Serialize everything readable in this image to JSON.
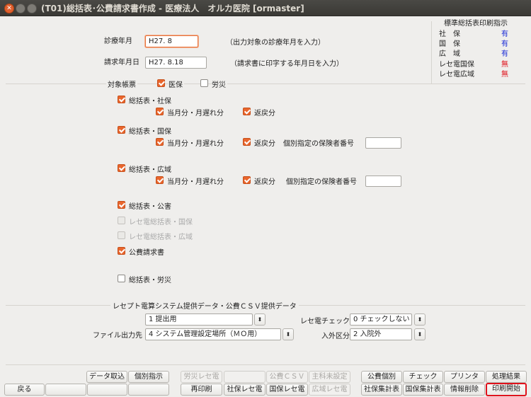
{
  "window": {
    "title": "(T01)総括表･公費請求書作成 - 医療法人　オルカ医院 [ormaster]"
  },
  "form": {
    "shinryo_label": "診療年月",
    "shinryo_value": "H27. 8",
    "shinryo_note": "（出力対象の診療年月を入力）",
    "seikyu_label": "請求年月日",
    "seikyu_value": "H27. 8.18",
    "seikyu_note": "（請求書に印字する年月日を入力）"
  },
  "status_panel": {
    "title": "標準総括表印刷指示",
    "rows": [
      {
        "label": "社　保",
        "value": "有",
        "color": "#1a2bd6"
      },
      {
        "label": "国　保",
        "value": "有",
        "color": "#1a2bd6"
      },
      {
        "label": "広　域",
        "value": "有",
        "color": "#1a2bd6"
      },
      {
        "label": "レセ電国保",
        "value": "無",
        "color": "#e0121c"
      },
      {
        "label": "レセ電広域",
        "value": "無",
        "color": "#e0121c"
      }
    ]
  },
  "target": {
    "label": "対象帳票",
    "iho": "医保",
    "rosai": "労災"
  },
  "options": {
    "shaho": "総括表・社保",
    "kokuho": "総括表・国保",
    "koiki": "総括表・広域",
    "tougetsu": "当月分・月遅れ分",
    "henrei": "返戻分",
    "kobetsu": "個別指定の保険者番号",
    "kogai": "総括表・公害",
    "rece_kokuho": "レセ電総括表・国保",
    "rece_koiki": "レセ電総括表・広域",
    "kouhi": "公費請求書",
    "rosai_summary": "総括表・労災"
  },
  "csv": {
    "section_title": "レセプト電算システム提供データ・公費ＣＳＶ提供データ",
    "teikyo_value": "1 提出用",
    "recheck_label": "レセ電チェック",
    "recheck_value": "0 チェックしない",
    "file_label": "ファイル出力先",
    "file_value": "4 システム管理設定場所（ＭＯ用）",
    "nyugai_label": "入外区分",
    "nyugai_value": "2 入院外"
  },
  "buttons": {
    "data_import": "データ取込",
    "kobetsu_shiji": "個別指示",
    "rousai_rece": "労災レセ電",
    "kouhi_csv": "公費ＣＳＶ",
    "main_ka": "主科未設定",
    "kouhi_kobetsu": "公費個別",
    "check": "チェック",
    "printer": "プリンタ",
    "shori_kekka": "処理結果",
    "back": "戻る",
    "reprint": "再印刷",
    "shaho_rece": "社保レセ電",
    "kokuho_rece": "国保レセ電",
    "koiki_rece": "広域レセ電",
    "shaho_shukei": "社保集計表",
    "kokuho_shukei": "国保集計表",
    "info_delete": "情報削除",
    "print_start": "印刷開始"
  }
}
